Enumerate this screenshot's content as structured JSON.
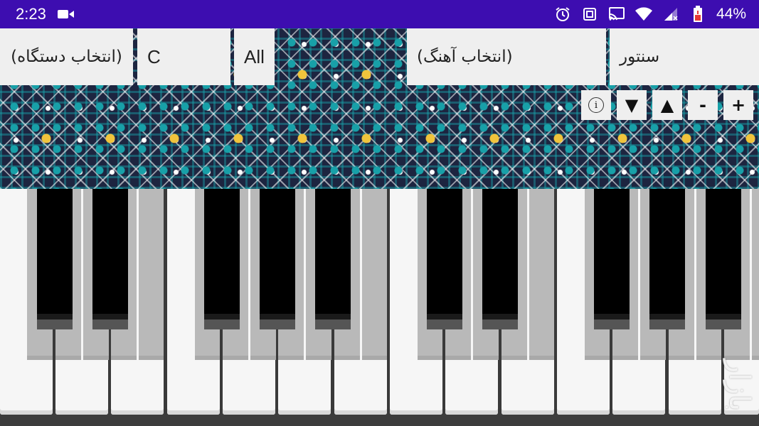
{
  "status_bar": {
    "time": "2:23",
    "battery_percent": "44%",
    "icons": [
      "video-camera-icon",
      "alarm-icon",
      "vibrate-icon",
      "cast-icon",
      "wifi-icon",
      "signal-icon",
      "battery-icon"
    ],
    "background_color": "#3d0db0"
  },
  "selectors": {
    "dastgah_label": "(انتخاب دستگاه)",
    "key_label": "C",
    "filter_label": "All",
    "song_label": "(انتخاب آهنگ)",
    "instrument_label": "سنتور"
  },
  "controls": {
    "info": "i",
    "down": "▼",
    "up": "▲",
    "minus": "-",
    "plus": "+"
  },
  "watermark": "بازار",
  "colors": {
    "panel_bg": "#efefef",
    "white_key": "#f6f6f6",
    "black_key": "#000000",
    "pattern_gold": "#f0c43c",
    "pattern_teal": "#18a0a8",
    "pattern_navy": "#1d2540"
  }
}
